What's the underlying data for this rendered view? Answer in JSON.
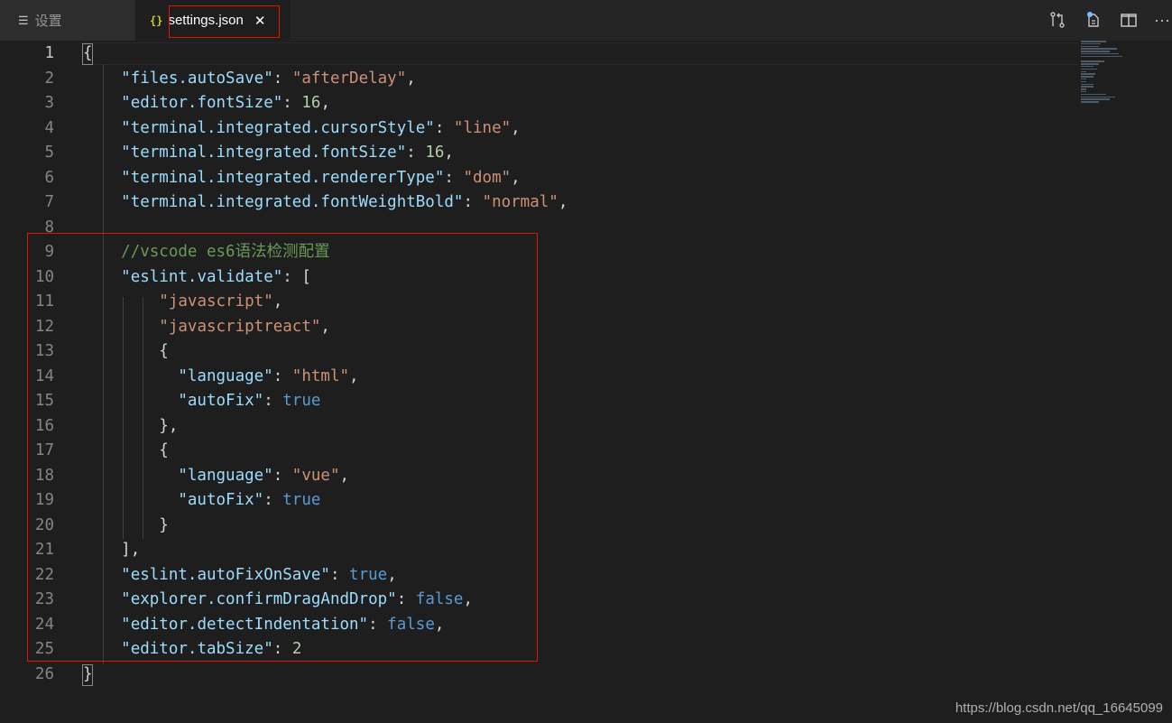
{
  "tabs": [
    {
      "label": "设置",
      "icon": "settings-list-icon",
      "active": false
    },
    {
      "label": "settings.json",
      "icon": "json-braces-icon",
      "active": true,
      "icon_text": "{}",
      "close_glyph": "✕"
    }
  ],
  "toolbar": [
    {
      "icon": "open-changes-icon"
    },
    {
      "icon": "open-settings-ui-icon"
    },
    {
      "icon": "split-editor-icon"
    },
    {
      "icon": "more-actions-icon",
      "glyph": "···"
    }
  ],
  "editor": {
    "language": "json",
    "active_line": 1,
    "lines": [
      {
        "num": "1",
        "tokens": [
          {
            "t": "{",
            "c": "p"
          }
        ]
      },
      {
        "num": "2",
        "tokens": [
          {
            "t": "    ",
            "c": "p"
          },
          {
            "t": "\"files.autoSave\"",
            "c": "k"
          },
          {
            "t": ": ",
            "c": "p"
          },
          {
            "t": "\"afterDelay\"",
            "c": "s"
          },
          {
            "t": ",",
            "c": "p"
          }
        ]
      },
      {
        "num": "3",
        "tokens": [
          {
            "t": "    ",
            "c": "p"
          },
          {
            "t": "\"editor.fontSize\"",
            "c": "k"
          },
          {
            "t": ": ",
            "c": "p"
          },
          {
            "t": "16",
            "c": "n"
          },
          {
            "t": ",",
            "c": "p"
          }
        ]
      },
      {
        "num": "4",
        "tokens": [
          {
            "t": "    ",
            "c": "p"
          },
          {
            "t": "\"terminal.integrated.cursorStyle\"",
            "c": "k"
          },
          {
            "t": ": ",
            "c": "p"
          },
          {
            "t": "\"line\"",
            "c": "s"
          },
          {
            "t": ",",
            "c": "p"
          }
        ]
      },
      {
        "num": "5",
        "tokens": [
          {
            "t": "    ",
            "c": "p"
          },
          {
            "t": "\"terminal.integrated.fontSize\"",
            "c": "k"
          },
          {
            "t": ": ",
            "c": "p"
          },
          {
            "t": "16",
            "c": "n"
          },
          {
            "t": ",",
            "c": "p"
          }
        ]
      },
      {
        "num": "6",
        "tokens": [
          {
            "t": "    ",
            "c": "p"
          },
          {
            "t": "\"terminal.integrated.rendererType\"",
            "c": "k"
          },
          {
            "t": ": ",
            "c": "p"
          },
          {
            "t": "\"dom\"",
            "c": "s"
          },
          {
            "t": ",",
            "c": "p"
          }
        ]
      },
      {
        "num": "7",
        "tokens": [
          {
            "t": "    ",
            "c": "p"
          },
          {
            "t": "\"terminal.integrated.fontWeightBold\"",
            "c": "k"
          },
          {
            "t": ": ",
            "c": "p"
          },
          {
            "t": "\"normal\"",
            "c": "s"
          },
          {
            "t": ",",
            "c": "p"
          }
        ]
      },
      {
        "num": "8",
        "tokens": []
      },
      {
        "num": "9",
        "tokens": [
          {
            "t": "    ",
            "c": "p"
          },
          {
            "t": "//vscode es6语法检测配置",
            "c": "c"
          }
        ]
      },
      {
        "num": "10",
        "tokens": [
          {
            "t": "    ",
            "c": "p"
          },
          {
            "t": "\"eslint.validate\"",
            "c": "k"
          },
          {
            "t": ": [",
            "c": "p"
          }
        ]
      },
      {
        "num": "11",
        "tokens": [
          {
            "t": "        ",
            "c": "p"
          },
          {
            "t": "\"javascript\"",
            "c": "s"
          },
          {
            "t": ",",
            "c": "p"
          }
        ]
      },
      {
        "num": "12",
        "tokens": [
          {
            "t": "        ",
            "c": "p"
          },
          {
            "t": "\"javascriptreact\"",
            "c": "s"
          },
          {
            "t": ",",
            "c": "p"
          }
        ]
      },
      {
        "num": "13",
        "tokens": [
          {
            "t": "        ",
            "c": "p"
          },
          {
            "t": "{",
            "c": "p"
          }
        ]
      },
      {
        "num": "14",
        "tokens": [
          {
            "t": "          ",
            "c": "p"
          },
          {
            "t": "\"language\"",
            "c": "k"
          },
          {
            "t": ": ",
            "c": "p"
          },
          {
            "t": "\"html\"",
            "c": "s"
          },
          {
            "t": ",",
            "c": "p"
          }
        ]
      },
      {
        "num": "15",
        "tokens": [
          {
            "t": "          ",
            "c": "p"
          },
          {
            "t": "\"autoFix\"",
            "c": "k"
          },
          {
            "t": ": ",
            "c": "p"
          },
          {
            "t": "true",
            "c": "b"
          }
        ]
      },
      {
        "num": "16",
        "tokens": [
          {
            "t": "        ",
            "c": "p"
          },
          {
            "t": "},",
            "c": "p"
          }
        ]
      },
      {
        "num": "17",
        "tokens": [
          {
            "t": "        ",
            "c": "p"
          },
          {
            "t": "{",
            "c": "p"
          }
        ]
      },
      {
        "num": "18",
        "tokens": [
          {
            "t": "          ",
            "c": "p"
          },
          {
            "t": "\"language\"",
            "c": "k"
          },
          {
            "t": ": ",
            "c": "p"
          },
          {
            "t": "\"vue\"",
            "c": "s"
          },
          {
            "t": ",",
            "c": "p"
          }
        ]
      },
      {
        "num": "19",
        "tokens": [
          {
            "t": "          ",
            "c": "p"
          },
          {
            "t": "\"autoFix\"",
            "c": "k"
          },
          {
            "t": ": ",
            "c": "p"
          },
          {
            "t": "true",
            "c": "b"
          }
        ]
      },
      {
        "num": "20",
        "tokens": [
          {
            "t": "        ",
            "c": "p"
          },
          {
            "t": "}",
            "c": "p"
          }
        ]
      },
      {
        "num": "21",
        "tokens": [
          {
            "t": "    ",
            "c": "p"
          },
          {
            "t": "],",
            "c": "p"
          }
        ]
      },
      {
        "num": "22",
        "tokens": [
          {
            "t": "    ",
            "c": "p"
          },
          {
            "t": "\"eslint.autoFixOnSave\"",
            "c": "k"
          },
          {
            "t": ": ",
            "c": "p"
          },
          {
            "t": "true",
            "c": "b"
          },
          {
            "t": ",",
            "c": "p"
          }
        ]
      },
      {
        "num": "23",
        "tokens": [
          {
            "t": "    ",
            "c": "p"
          },
          {
            "t": "\"explorer.confirmDragAndDrop\"",
            "c": "k"
          },
          {
            "t": ": ",
            "c": "p"
          },
          {
            "t": "false",
            "c": "b"
          },
          {
            "t": ",",
            "c": "p"
          }
        ]
      },
      {
        "num": "24",
        "tokens": [
          {
            "t": "    ",
            "c": "p"
          },
          {
            "t": "\"editor.detectIndentation\"",
            "c": "k"
          },
          {
            "t": ": ",
            "c": "p"
          },
          {
            "t": "false",
            "c": "b"
          },
          {
            "t": ",",
            "c": "p"
          }
        ]
      },
      {
        "num": "25",
        "tokens": [
          {
            "t": "    ",
            "c": "p"
          },
          {
            "t": "\"editor.tabSize\"",
            "c": "k"
          },
          {
            "t": ": ",
            "c": "p"
          },
          {
            "t": "2",
            "c": "n"
          }
        ]
      },
      {
        "num": "26",
        "tokens": [
          {
            "t": "}",
            "c": "p"
          }
        ]
      }
    ]
  },
  "colors": {
    "editor_bg": "#1e1e1e",
    "tab_bar_bg": "#252526",
    "key": "#9cdcfe",
    "string": "#ce9178",
    "number": "#b5cea8",
    "boolean": "#569cd6",
    "comment": "#6a9955",
    "highlight_annotation": "#e51400"
  },
  "watermark": "https://blog.csdn.net/qq_16645099"
}
